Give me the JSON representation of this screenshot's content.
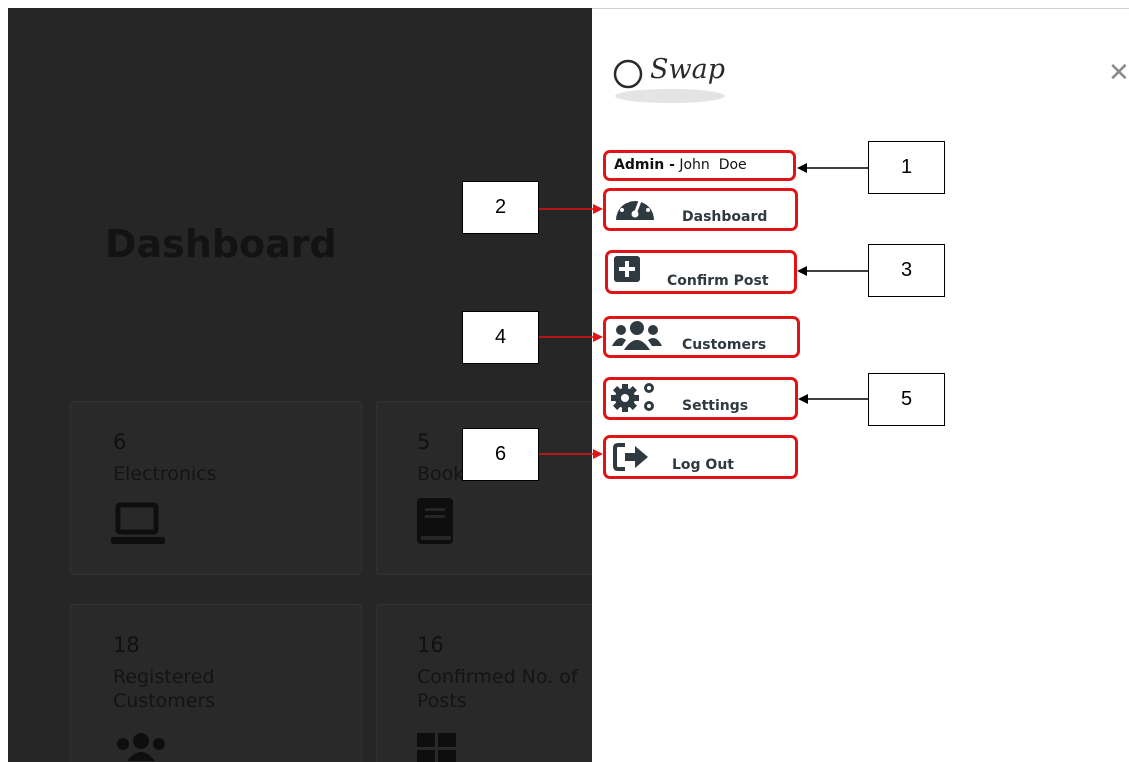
{
  "background": {
    "title": "Dashboard",
    "cards": [
      {
        "count": "6",
        "label": "Electronics",
        "icon": "laptop-icon"
      },
      {
        "count": "5",
        "label": "Books",
        "icon": "book-icon"
      },
      {
        "count": "18",
        "label": "Registered Customers",
        "icon": "users-icon"
      },
      {
        "count": "16",
        "label": "Confirmed No. of Posts",
        "icon": "grid-icon"
      }
    ]
  },
  "drawer": {
    "logo_text": "Swap",
    "close_icon": "close-icon",
    "user_role": "Admin -",
    "user_name": "John  Doe",
    "menu": [
      {
        "label": "Dashboard",
        "icon": "speedometer-icon"
      },
      {
        "label": "Confirm Post",
        "icon": "plus-square-icon"
      },
      {
        "label": "Customers",
        "icon": "users-icon"
      },
      {
        "label": "Settings",
        "icon": "gears-icon"
      },
      {
        "label": "Log Out",
        "icon": "sign-out-icon"
      }
    ]
  },
  "callouts": [
    "1",
    "2",
    "3",
    "4",
    "5",
    "6"
  ],
  "colors": {
    "highlight": "#e01414",
    "overlay": "#262626",
    "menu_text": "#2f3a40"
  }
}
